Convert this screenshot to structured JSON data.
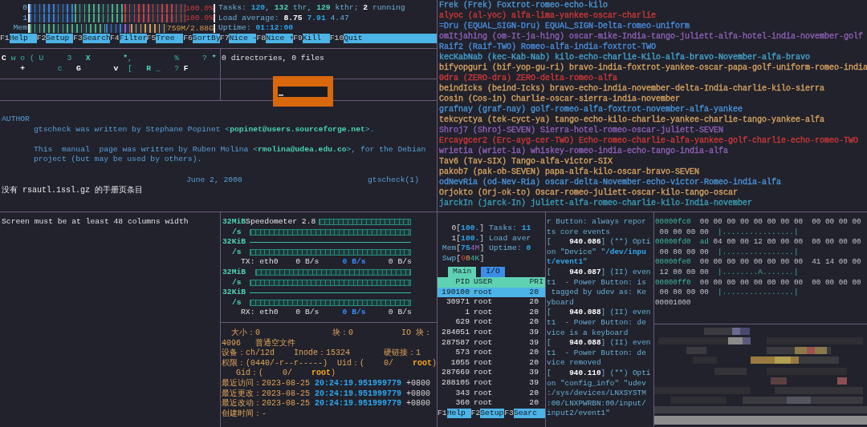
{
  "top_left": {
    "htop": {
      "meters": [
        {
          "label": "0",
          "kind": "cpu",
          "level": 1,
          "reading": "100.0%"
        },
        {
          "label": "1",
          "kind": "cpu",
          "level": 1,
          "reading": "100.0%"
        },
        {
          "label": "Mem",
          "kind": "memory",
          "level": 1,
          "reading": "759M/2.88G"
        }
      ],
      "stats": [
        [
          {
            "text": "Tasks: ",
            "kind": "label"
          },
          {
            "text": "120",
            "kind": "value"
          },
          {
            "text": ", ",
            "kind": "label"
          },
          {
            "text": "132",
            "kind": "teal_bold"
          },
          {
            "text": " thr, ",
            "kind": "label"
          },
          {
            "text": "129",
            "kind": "teal_bold"
          },
          {
            "text": " kthr; ",
            "kind": "label"
          },
          {
            "text": "2",
            "kind": "bright"
          },
          {
            "text": " running",
            "kind": "label"
          }
        ],
        [
          {
            "text": "Load average: ",
            "kind": "label"
          },
          {
            "text": "8.75 ",
            "kind": "bright"
          },
          {
            "text": "7.91",
            "kind": "value"
          },
          {
            "text": " 4.47",
            "kind": "label"
          }
        ],
        [
          {
            "text": "Uptime: ",
            "kind": "label"
          },
          {
            "text": "01:12:00",
            "kind": "value"
          }
        ]
      ],
      "function_keys": [
        {
          "key": "F1",
          "label": "Help"
        },
        {
          "key": "F2",
          "label": "Setup"
        },
        {
          "key": "F3",
          "label": "Search"
        },
        {
          "key": "F4",
          "label": "Filter"
        },
        {
          "key": "F5",
          "label": "Tree"
        },
        {
          "key": "F6",
          "label": "SortBy"
        },
        {
          "key": "F7",
          "label": "Nice -"
        },
        {
          "key": "F8",
          "label": "Nice +"
        },
        {
          "key": "F9",
          "label": "Kill"
        },
        {
          "key": "F10",
          "label": "Quit"
        }
      ]
    },
    "matrix": [
      [
        {
          "text": "C",
          "kind": "bright"
        },
        {
          "text": " w o ( U     3   ",
          "kind": "teal"
        },
        {
          "text": "X       *",
          "kind": "teal_bold"
        },
        {
          "text": ",         %     ? ",
          "kind": "teal"
        },
        {
          "text": "*",
          "kind": "teal_bold"
        }
      ],
      [
        {
          "text": "    +",
          "kind": "bright"
        },
        {
          "text": "       c   ",
          "kind": "teal"
        },
        {
          "text": "G       v",
          "kind": "bright"
        },
        {
          "text": "  [   ",
          "kind": "teal"
        },
        {
          "text": "R",
          "kind": "teal_bold"
        },
        {
          "text": " _   ? ",
          "kind": "teal"
        },
        {
          "text": "F",
          "kind": "bright"
        }
      ]
    ],
    "tree_output": "0 directories, 0 files",
    "man_page": {
      "section": "AUTHOR",
      "paragraphs": [
        [
          [
            {
              "text": "gtscheck was written by Stephane Popinet <",
              "kind": "manual"
            },
            {
              "text": "popinet@users.sourceforge.net",
              "kind": "email"
            },
            {
              "text": ">.",
              "kind": "manual"
            }
          ]
        ],
        [
          [
            {
              "text": "This  manual  page was written by Ruben Molina <",
              "kind": "manual"
            },
            {
              "text": "rmolina@udea.edu.co",
              "kind": "email"
            },
            {
              "text": ">, for the Debian",
              "kind": "manual"
            }
          ],
          [
            {
              "text": "project (but may be used by others).",
              "kind": "manual"
            }
          ]
        ]
      ],
      "footer": {
        "date": "June 2, 2008",
        "title": "gtscheck(1)"
      },
      "message": "没有 rsautl.1ssl.gz 的手册页条目"
    }
  },
  "word_list": [
    {
      "text": "Frek (Frek) Foxtrot-romeo-echo-kilo",
      "color": "#4e9ad8"
    },
    {
      "text": "alyoc (al-yoc) alfa-lima-yankee-oscar-charlie",
      "color": "#d03838"
    },
    {
      "text": "=Dru (EQUAL_SIGN-Dru) EQUAL_SIGN-Delta-romeo-uniform",
      "color": "#4a8ee0"
    },
    {
      "text": "omItjahing (om-It-ja-hing) oscar-mike-India-tango-juliett-alfa-hotel-india-november-golf",
      "color": "#9060b8"
    },
    {
      "text": "Raif2 (Raif-TWO) Romeo-alfa-india-foxtrot-TWO",
      "color": "#4a8ee0"
    },
    {
      "text": "kecKabNab (kec-Kab-Nab) kilo-echo-charlie-Kilo-alfa-bravo-November-alfa-bravo",
      "color": "#45a5d0"
    },
    {
      "text": "bifyopguri (bif-yop-gu-ri) bravo-india-foxtrot-yankee-oscar-papa-golf-uniform-romeo-india",
      "color": "#d8a460"
    },
    {
      "text": "0dra (ZERO-dra) ZERO-delta-romeo-alfa",
      "color": "#d03838"
    },
    {
      "text": "beindIcks (beind-Icks) bravo-echo-india-november-delta-India-charlie-kilo-sierra",
      "color": "#d8a460"
    },
    {
      "text": "Cosin (Cos-in) Charlie-oscar-sierra-india-november",
      "color": "#d8a460"
    },
    {
      "text": "grafnay (graf-nay) golf-romeo-alfa-foxtrot-november-alfa-yankee",
      "color": "#4a95d8"
    },
    {
      "text": "tekcyctya (tek-cyct-ya) tango-echo-kilo-charlie-yankee-charlie-tango-yankee-alfa",
      "color": "#d8a460"
    },
    {
      "text": "Shroj7 (Shroj-SEVEN) Sierra-hotel-romeo-oscar-juliett-SEVEN",
      "color": "#9060b8"
    },
    {
      "text": "Ercaygcer2 (Erc-ayg-cer-TWO) Echo-romeo-charlie-alfa-yankee-golf-charlie-echo-romeo-TWO",
      "color": "#d03838"
    },
    {
      "text": "wrietia (wriet-ia) whiskey-romeo-india-echo-tango-india-alfa",
      "color": "#9060b8"
    },
    {
      "text": "Tav6 (Tav-SIX) Tango-alfa-victor-SIX",
      "color": "#d8a460"
    },
    {
      "text": "pakob7 (pak-ob-SEVEN) papa-alfa-kilo-oscar-bravo-SEVEN",
      "color": "#d8a460"
    },
    {
      "text": "odNevRia (od-Nev-Ria) oscar-delta-November-echo-victor-Romeo-india-alfa",
      "color": "#4a95d8"
    },
    {
      "text": "Orjokto (Orj-ok-to) Oscar-romeo-juliett-oscar-kilo-tango-oscar",
      "color": "#d8a460"
    },
    {
      "text": "jarckIn (jarck-In) juliett-alfa-romeo-charlie-kilo-India-november",
      "color": "#3aa0b8"
    }
  ],
  "width_notice": "Screen must be at least 48 columns width",
  "speedometer": {
    "title": "Speedometer 2.8",
    "channels": [
      {
        "label": "TX: eth0",
        "scale_top": "32MiB",
        "scale_bottom": "32KiB",
        "unit_top": "/s",
        "unit_bottom": "/s",
        "readings": [
          "0 B/s",
          "0 B/s",
          "0 B/s"
        ]
      },
      {
        "label": "RX: eth0",
        "scale_top": "32MiB",
        "scale_bottom": "32KiB",
        "unit_top": "/s",
        "unit_bottom": "/s",
        "readings": [
          "0 B/s",
          "0 B/s",
          "0 B/s"
        ]
      }
    ]
  },
  "file_stat": [
    [
      {
        "text": "  大小：0               块：0          IO 块：",
        "kind": "orange"
      }
    ],
    [
      {
        "text": "4096   普通空文件",
        "kind": "orange"
      }
    ],
    [
      {
        "text": "设备：ch/12d    Inode：15324       硬链接：1",
        "kind": "orange"
      }
    ],
    [
      {
        "text": "权限：(0440/-r--r-----)  Uid：(    0/    ",
        "kind": "orange"
      },
      {
        "text": "root",
        "kind": "orange_bold"
      },
      {
        "text": ")",
        "kind": "orange"
      }
    ],
    [
      {
        "text": "   Gid：(    0/    ",
        "kind": "orange"
      },
      {
        "text": "root",
        "kind": "orange_bold"
      },
      {
        "text": ")",
        "kind": "orange"
      }
    ],
    [
      {
        "text": "最近访问：2023-08-25 ",
        "kind": "orange"
      },
      {
        "text": "20:24:19.951999779",
        "kind": "value"
      },
      {
        "text": " +0800",
        "kind": "plain"
      }
    ],
    [
      {
        "text": "最近更改：2023-08-25 ",
        "kind": "orange"
      },
      {
        "text": "20:24:19.951999779",
        "kind": "value"
      },
      {
        "text": " +0800",
        "kind": "plain"
      }
    ],
    [
      {
        "text": "最近改动：2023-08-25 ",
        "kind": "orange"
      },
      {
        "text": "20:24:19.951999779",
        "kind": "value"
      },
      {
        "text": " +0800",
        "kind": "plain"
      }
    ],
    [
      {
        "text": "创建时间：-",
        "kind": "orange"
      }
    ]
  ],
  "htop_small": {
    "meters": [
      [
        {
          "text": "   0[",
          "kind": "plain"
        },
        {
          "text": "100.",
          "kind": "value"
        },
        {
          "text": "] ",
          "kind": "plain"
        },
        {
          "text": "Tasks: ",
          "kind": "label"
        },
        {
          "text": "11",
          "kind": "value"
        }
      ],
      [
        {
          "text": "   1[",
          "kind": "plain"
        },
        {
          "text": "100.",
          "kind": "value"
        },
        {
          "text": "] ",
          "kind": "plain"
        },
        {
          "text": "Load aver",
          "kind": "label"
        }
      ],
      [
        {
          "text": " Mem",
          "kind": "label"
        },
        {
          "text": "[",
          "kind": "plain"
        },
        {
          "text": "75",
          "kind": "value"
        },
        {
          "text": "4M",
          "kind": "purple"
        },
        {
          "text": "] ",
          "kind": "plain"
        },
        {
          "text": "Uptime: ",
          "kind": "label"
        },
        {
          "text": "0",
          "kind": "value"
        }
      ],
      [
        {
          "text": " Swp",
          "kind": "label"
        },
        {
          "text": "[",
          "kind": "plain"
        },
        {
          "text": "9",
          "kind": "red"
        },
        {
          "text": "0",
          "kind": "orange"
        },
        {
          "text": "4K",
          "kind": "teal"
        },
        {
          "text": "]",
          "kind": "plain"
        }
      ]
    ],
    "tabs": [
      {
        "label": "Main",
        "selected": true
      },
      {
        "label": "I/O",
        "selected": false
      }
    ],
    "columns": [
      "PID",
      "USER",
      "PRI"
    ],
    "rows": [
      {
        "pid": "190100",
        "user": "root",
        "pri": "20",
        "selected": true
      },
      {
        "pid": "30971",
        "user": "root",
        "pri": "20",
        "selected": false
      },
      {
        "pid": "1",
        "user": "root",
        "pri": "20",
        "selected": false
      },
      {
        "pid": "629",
        "user": "root",
        "pri": "20",
        "selected": false
      },
      {
        "pid": "284051",
        "user": "root",
        "pri": "39",
        "selected": false
      },
      {
        "pid": "287587",
        "user": "root",
        "pri": "39",
        "selected": false
      },
      {
        "pid": "573",
        "user": "root",
        "pri": "20",
        "selected": false
      },
      {
        "pid": "1055",
        "user": "root",
        "pri": "20",
        "selected": false
      },
      {
        "pid": "287669",
        "user": "root",
        "pri": "39",
        "selected": false
      },
      {
        "pid": "288105",
        "user": "root",
        "pri": "39",
        "selected": false
      },
      {
        "pid": "343",
        "user": "root",
        "pri": "20",
        "selected": false
      },
      {
        "pid": "360",
        "user": "root",
        "pri": "20",
        "selected": false
      }
    ],
    "function_keys": [
      {
        "key": "F1",
        "label": "Help"
      },
      {
        "key": "F2",
        "label": "Setup"
      },
      {
        "key": "F3",
        "label": "Searc"
      }
    ]
  },
  "log": [
    [
      {
        "text": "r Button: always repor",
        "kind": "log"
      }
    ],
    [
      {
        "text": "ts core events",
        "kind": "log"
      }
    ],
    [
      {
        "text": "[    ",
        "kind": "log"
      },
      {
        "text": "940.086",
        "kind": "bright"
      },
      {
        "text": "] (**) Opti",
        "kind": "log"
      }
    ],
    [
      {
        "text": "on \"Device\" \"",
        "kind": "log"
      },
      {
        "text": "/dev/inpu",
        "kind": "path"
      }
    ],
    [
      {
        "text": "t/event1",
        "kind": "path"
      },
      {
        "text": "\"",
        "kind": "log"
      }
    ],
    [
      {
        "text": "[    ",
        "kind": "log"
      },
      {
        "text": "940.087",
        "kind": "bright"
      },
      {
        "text": "] (II) even",
        "kind": "log"
      }
    ],
    [
      {
        "text": "t1  - Power Button: is",
        "kind": "log"
      }
    ],
    [
      {
        "text": " tagged by udev as: Ke",
        "kind": "log"
      }
    ],
    [
      {
        "text": "yboard",
        "kind": "log"
      }
    ],
    [
      {
        "text": "[    ",
        "kind": "log"
      },
      {
        "text": "940.088",
        "kind": "bright"
      },
      {
        "text": "] (II) even",
        "kind": "log"
      }
    ],
    [
      {
        "text": "t1  - Power Button: de",
        "kind": "log"
      }
    ],
    [
      {
        "text": "vice is a keyboard",
        "kind": "log"
      }
    ],
    [
      {
        "text": "[    ",
        "kind": "log"
      },
      {
        "text": "940.088",
        "kind": "bright"
      },
      {
        "text": "] (II) even",
        "kind": "log"
      }
    ],
    [
      {
        "text": "t1  - Power Button: de",
        "kind": "log"
      }
    ],
    [
      {
        "text": "vice removed",
        "kind": "log"
      }
    ],
    [
      {
        "text": "[    ",
        "kind": "log"
      },
      {
        "text": "940.110",
        "kind": "bright"
      },
      {
        "text": "] (**) Opti",
        "kind": "log"
      }
    ],
    [
      {
        "text": "on \"config_info\" \"udev",
        "kind": "log"
      }
    ],
    [
      {
        "text": ":/sys/devices/LNXSYSTM",
        "kind": "log"
      }
    ],
    [
      {
        "text": ":00/LNXPWRBN:00/input/",
        "kind": "log"
      }
    ],
    [
      {
        "text": "input2/event1\"",
        "kind": "log"
      }
    ]
  ],
  "hexdump": [
    [
      {
        "text": "00000fc0",
        "kind": "hex_addr"
      },
      {
        "text": "  00 00 00 00 00 00 00 00  00 00 00 00",
        "kind": "hex"
      }
    ],
    [
      {
        "text": " 00 00 00 00  ",
        "kind": "hex"
      },
      {
        "text": "|................|",
        "kind": "hex_addr"
      }
    ],
    [
      {
        "text": "00000fd0  ad",
        "kind": "hex_addr"
      },
      {
        "text": " 04 00 00 12 00 00 00  00 00 00 00",
        "kind": "hex"
      }
    ],
    [
      {
        "text": " 00 00 00 00  ",
        "kind": "hex"
      },
      {
        "text": "|................|",
        "kind": "hex_addr"
      }
    ],
    [
      {
        "text": "00000fe0",
        "kind": "hex_addr"
      },
      {
        "text": "  00 00 00 00 00 00 00 00  41 14 00 00",
        "kind": "hex"
      }
    ],
    [
      {
        "text": " 12 00 00 00  ",
        "kind": "hex"
      },
      {
        "text": "|........A.......|",
        "kind": "hex_addr"
      }
    ],
    [
      {
        "text": "00000ff0",
        "kind": "hex_addr"
      },
      {
        "text": "  00 00 00 00 00 00 00 00  00 00 00 00",
        "kind": "hex"
      }
    ],
    [
      {
        "text": " 00 00 00 00  ",
        "kind": "hex"
      },
      {
        "text": "|................|",
        "kind": "hex_addr"
      }
    ],
    [
      {
        "text": "00001000",
        "kind": "hex"
      }
    ]
  ]
}
